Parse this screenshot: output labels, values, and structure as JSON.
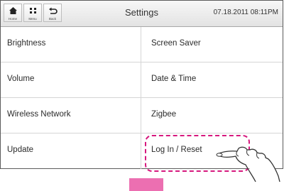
{
  "header": {
    "title": "Settings",
    "datetime": "07.18.2011 08:11PM",
    "buttons": [
      {
        "label": "Home",
        "icon": "home-icon"
      },
      {
        "label": "Menu",
        "icon": "menu-icon"
      },
      {
        "label": "Back",
        "icon": "back-icon"
      }
    ]
  },
  "menu": {
    "items": [
      {
        "label": "Brightness"
      },
      {
        "label": "Screen Saver"
      },
      {
        "label": "Volume"
      },
      {
        "label": "Date & Time"
      },
      {
        "label": "Wireless Network"
      },
      {
        "label": "Zigbee"
      },
      {
        "label": "Update"
      },
      {
        "label": "Log In / Reset"
      }
    ]
  },
  "annotation": {
    "highlight_color": "#d6187e",
    "marker_color": "#ec6fb1",
    "pointer_icon": "pointing-hand-icon"
  }
}
